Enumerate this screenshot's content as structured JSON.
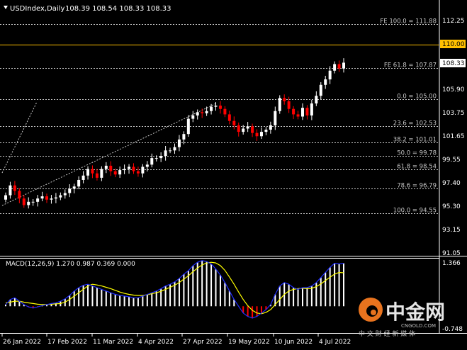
{
  "header": {
    "symbol": "USDIndex,Daily",
    "ohlc": "108.39 108.54 108.33 108.33"
  },
  "price_axis": {
    "labels": [
      "112.25",
      "110.00",
      "108.33",
      "105.90",
      "103.75",
      "101.65",
      "99.55",
      "97.40",
      "95.30",
      "93.15",
      "91.05"
    ],
    "highlight_label": "110.00",
    "current_label": "108.33"
  },
  "levels": [
    {
      "label": "FE 100.0 = 111.88",
      "price": 111.88
    },
    {
      "label": "FE 61.8 = 107.87",
      "price": 107.87
    },
    {
      "label": "0.0 = 105.00",
      "price": 105.0
    },
    {
      "label": "23.6 = 102.53",
      "price": 102.53
    },
    {
      "label": "38.2 = 101.01",
      "price": 101.01
    },
    {
      "label": "50.0 = 99.78",
      "price": 99.78
    },
    {
      "label": "61.8 = 98.54",
      "price": 98.54
    },
    {
      "label": "78.6 = 96.79",
      "price": 96.79
    },
    {
      "label": "100.0 = 94.55",
      "price": 94.55
    }
  ],
  "horizontal_line": {
    "price": 110.0,
    "color": "#ffc000"
  },
  "macd": {
    "title": "MACD(12,26,9) 1.270 0.987 0.369 0.000",
    "axis_top": "1.366",
    "axis_bottom": "-0.748"
  },
  "date_axis": {
    "labels": [
      "26 Jan 2022",
      "17 Feb 2022",
      "11 Mar 2022",
      "4 Apr 2022",
      "27 Apr 2022",
      "19 May 2022",
      "10 Jun 2022",
      "4 Jul 2022"
    ]
  },
  "watermark": {
    "brand": "中金网",
    "site": "CNGOLD.COM",
    "slogan": "中 文 财 经 新 媒 体"
  },
  "colors": {
    "bull": "#ffffff",
    "bear": "#ff0000",
    "fib": "#c8c8c8",
    "macd_main": "#ffff00",
    "macd_signal": "#1e2dff",
    "accent": "#ffc000"
  },
  "chart_data": {
    "type": "candlestick",
    "title": "USDIndex,Daily",
    "ylim": [
      91.05,
      112.25
    ],
    "series": [
      {
        "name": "USDIndex",
        "values": [
          96.2,
          97.1,
          96.6,
          95.9,
          95.3,
          95.6,
          95.6,
          95.9,
          96.1,
          95.8,
          95.9,
          96.0,
          96.2,
          96.4,
          96.8,
          97.0,
          97.6,
          98.0,
          98.6,
          98.2,
          97.8,
          98.6,
          98.9,
          98.4,
          98.1,
          98.5,
          98.6,
          98.8,
          98.4,
          98.2,
          98.8,
          99.0,
          99.6,
          99.6,
          99.8,
          100.3,
          100.3,
          100.6,
          101.3,
          101.8,
          103.2,
          103.5,
          103.8,
          103.7,
          103.9,
          104.3,
          104.4,
          104.1,
          103.6,
          103.0,
          102.6,
          102.0,
          102.3,
          102.5,
          101.9,
          101.6,
          102.0,
          102.2,
          102.6,
          103.9,
          105.1,
          104.8,
          104.1,
          103.6,
          103.4,
          104.2,
          103.5,
          104.6,
          105.3,
          106.3,
          106.8,
          107.6,
          108.2,
          107.8,
          108.33
        ]
      },
      {
        "name": "MACD(12,26,9)",
        "values": [
          0.05,
          0.2,
          0.25,
          0.15,
          0.05,
          -0.02,
          -0.05,
          -0.02,
          0.02,
          0.05,
          0.08,
          0.1,
          0.15,
          0.22,
          0.32,
          0.45,
          0.55,
          0.62,
          0.65,
          0.6,
          0.55,
          0.5,
          0.45,
          0.4,
          0.35,
          0.32,
          0.3,
          0.28,
          0.25,
          0.25,
          0.3,
          0.35,
          0.4,
          0.45,
          0.52,
          0.6,
          0.65,
          0.72,
          0.82,
          0.95,
          1.05,
          1.2,
          1.3,
          1.35,
          1.32,
          1.25,
          1.1,
          0.92,
          0.7,
          0.45,
          0.2,
          0.0,
          -0.2,
          -0.3,
          -0.35,
          -0.3,
          -0.2,
          -0.1,
          0.05,
          0.35,
          0.6,
          0.7,
          0.65,
          0.55,
          0.5,
          0.55,
          0.55,
          0.6,
          0.7,
          0.85,
          1.0,
          1.15,
          1.27,
          1.25,
          1.27
        ]
      },
      {
        "name": "Signal",
        "values": [
          0.1,
          0.12,
          0.15,
          0.15,
          0.12,
          0.1,
          0.08,
          0.06,
          0.05,
          0.05,
          0.06,
          0.07,
          0.08,
          0.12,
          0.2,
          0.3,
          0.4,
          0.5,
          0.6,
          0.65,
          0.63,
          0.6,
          0.56,
          0.52,
          0.47,
          0.42,
          0.38,
          0.35,
          0.33,
          0.32,
          0.32,
          0.34,
          0.37,
          0.4,
          0.44,
          0.5,
          0.56,
          0.62,
          0.7,
          0.8,
          0.9,
          1.02,
          1.13,
          1.22,
          1.28,
          1.3,
          1.28,
          1.2,
          1.06,
          0.86,
          0.65,
          0.42,
          0.2,
          0.02,
          -0.12,
          -0.2,
          -0.22,
          -0.18,
          -0.1,
          0.05,
          0.2,
          0.35,
          0.45,
          0.5,
          0.52,
          0.53,
          0.52,
          0.53,
          0.58,
          0.66,
          0.76,
          0.86,
          0.95,
          1.0,
          0.99
        ]
      }
    ]
  }
}
